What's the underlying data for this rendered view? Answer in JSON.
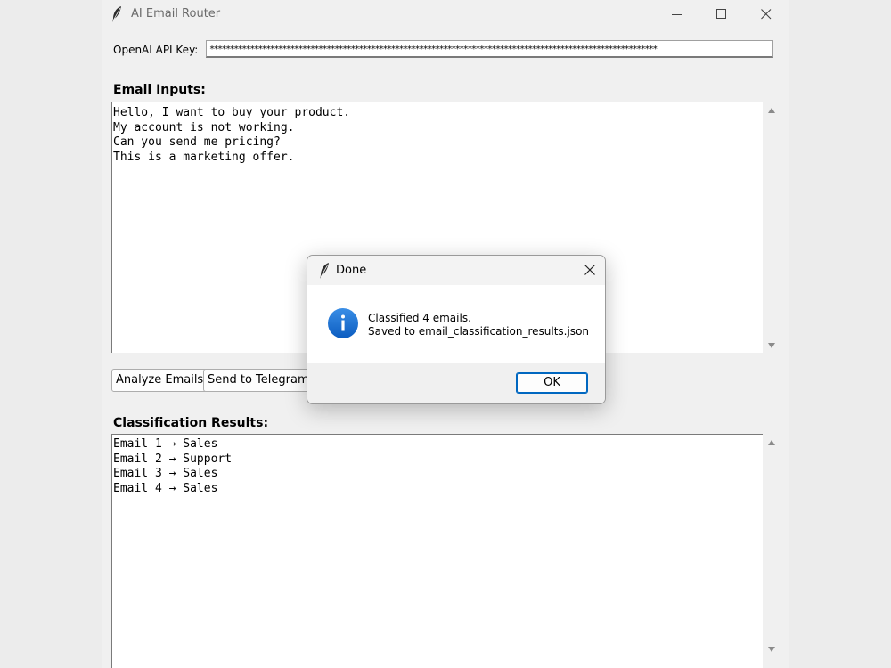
{
  "window": {
    "title": "AI Email Router",
    "controls": [
      "minimize-icon",
      "maximize-icon",
      "close-icon"
    ]
  },
  "api_key": {
    "label": "OpenAI API Key:",
    "value": "***************************************************************************************************************"
  },
  "email_inputs": {
    "label": "Email Inputs:",
    "lines": [
      "Hello, I want to buy your product.",
      "My account is not working.",
      "Can you send me pricing?",
      "This is a marketing offer."
    ]
  },
  "buttons": {
    "analyze": "Analyze Emails",
    "telegram": "Send to Telegram"
  },
  "results": {
    "label": "Classification Results:",
    "lines": [
      "Email 1 → Sales",
      "Email 2 → Support",
      "Email 3 → Sales",
      "Email 4 → Sales"
    ]
  },
  "dialog": {
    "title": "Done",
    "message_line1": "Classified 4 emails.",
    "message_line2": "Saved to email_classification_results.json",
    "ok_label": "OK",
    "icon": "info-icon",
    "accent": "#1a73d4"
  }
}
